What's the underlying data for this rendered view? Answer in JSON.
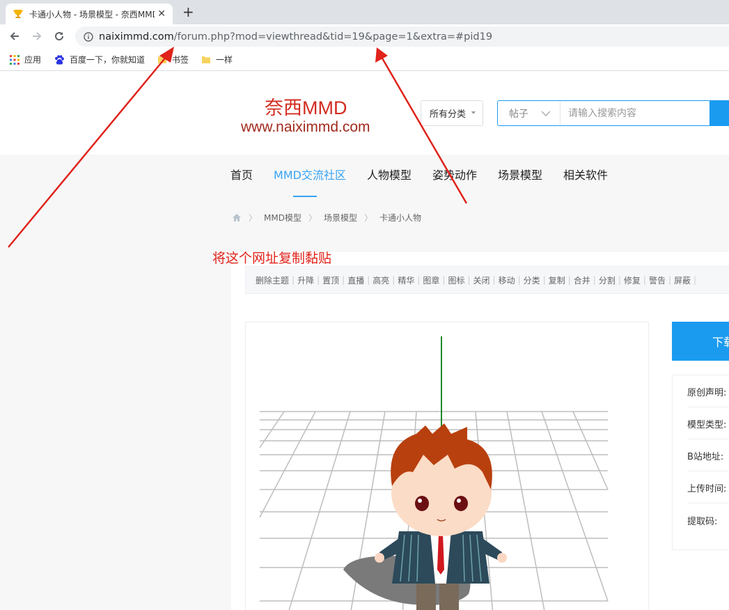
{
  "browser": {
    "tab_title": "卡通小人物 - 场景模型 - 奈西MMD",
    "tab_close": "✕",
    "new_tab": "+",
    "url_host": "naiximmd.com",
    "url_path": "/forum.php?mod=viewthread&tid=19&page=1&extra=#pid19",
    "bookmarks": [
      "应用",
      "百度一下，你就知道",
      "书签",
      "一样"
    ]
  },
  "site": {
    "logo_cn": "奈西MMD",
    "logo_url": "www.naiximmd.com",
    "category_select": "所有分类",
    "search_type": "帖子",
    "search_placeholder": "请输入搜索内容"
  },
  "nav": {
    "items": [
      "首页",
      "MMD交流社区",
      "人物模型",
      "姿势动作",
      "场景模型",
      "相关软件"
    ],
    "active_index": 1
  },
  "breadcrumb": [
    "MMD模型",
    "场景模型",
    "卡通小人物"
  ],
  "annotation": "将这个网址复制黏贴",
  "mod_tools": [
    "删除主题",
    "升降",
    "置顶",
    "直播",
    "高亮",
    "精华",
    "图章",
    "图标",
    "关闭",
    "移动",
    "分类",
    "复制",
    "合并",
    "分割",
    "修复",
    "警告",
    "屏蔽"
  ],
  "download_button": "下载",
  "info_rows": [
    "原创声明:",
    "模型类型:",
    "B站地址:",
    "上传时间:",
    "提取码:"
  ],
  "colors": {
    "accent": "#1a9bf0",
    "nav_active": "#35a3f2",
    "logo_red": "#d22b1f",
    "annotation_red": "#e0231b"
  }
}
